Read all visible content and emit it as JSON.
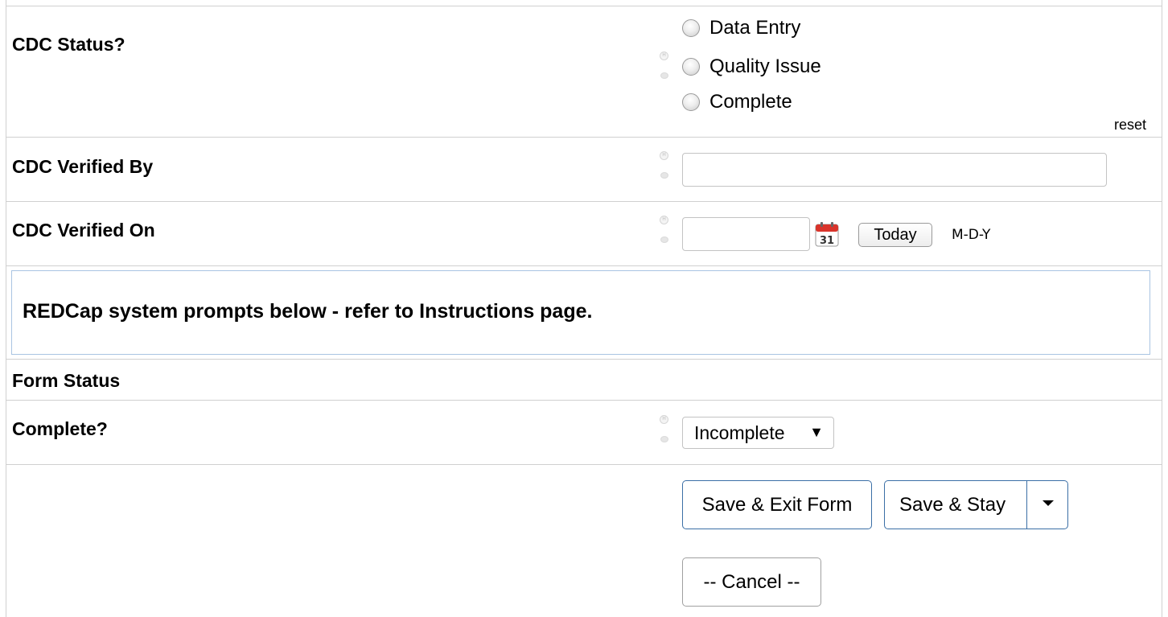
{
  "fields": {
    "cdc_status": {
      "label": "CDC Status?",
      "options": [
        "Data Entry",
        "Quality Issue",
        "Complete"
      ],
      "reset_label": "reset"
    },
    "cdc_verified_by": {
      "label": "CDC Verified By",
      "value": ""
    },
    "cdc_verified_on": {
      "label": "CDC Verified On",
      "value": "",
      "today_label": "Today",
      "format_label": "M-D-Y",
      "calendar_day": "31"
    }
  },
  "info_box": {
    "text": "REDCap system prompts below - refer to Instructions page."
  },
  "form_status": {
    "section_label": "Form Status",
    "complete_label": "Complete?",
    "complete_value": "Incomplete",
    "dropdown_arrow": "▼"
  },
  "actions": {
    "save_exit_label": "Save & Exit Form",
    "save_stay_label": "Save & Stay",
    "cancel_label": "-- Cancel --"
  },
  "colors": {
    "border": "#d0d0d0",
    "info_border": "#a9c4e2",
    "primary_button_border": "#3b6fa6",
    "calendar_red": "#d9342b"
  }
}
